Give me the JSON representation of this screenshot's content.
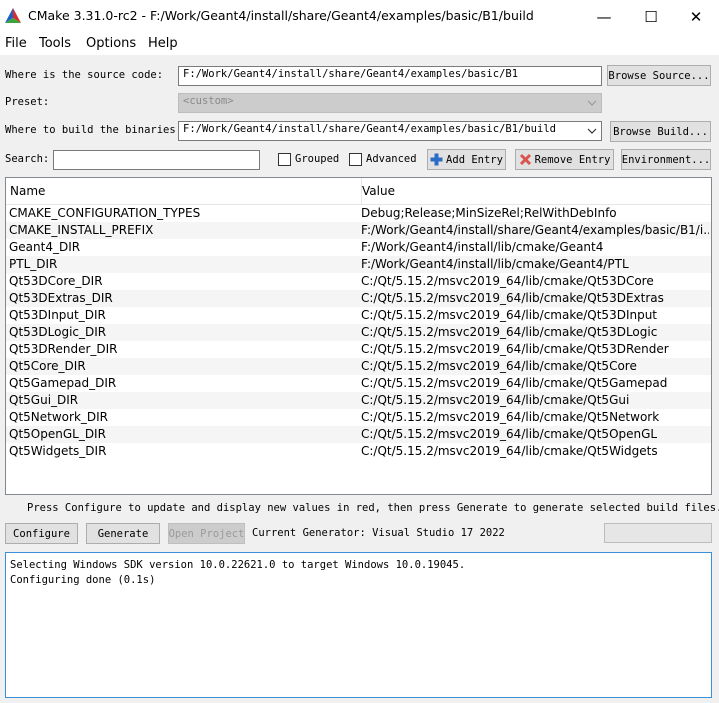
{
  "window": {
    "title": "CMake 3.31.0-rc2 - F:/Work/Geant4/install/share/Geant4/examples/basic/B1/build",
    "controls": {
      "minimize": "—",
      "maximize": "☐",
      "close": "✕"
    }
  },
  "menu": [
    "File",
    "Tools",
    "Options",
    "Help"
  ],
  "source": {
    "label": "Where is the source code:",
    "value": "F:/Work/Geant4/install/share/Geant4/examples/basic/B1",
    "button": "Browse Source..."
  },
  "preset": {
    "label": "Preset:",
    "value": "<custom>"
  },
  "build": {
    "label": "Where to build the binaries:",
    "value": "F:/Work/Geant4/install/share/Geant4/examples/basic/B1/build",
    "button": "Browse Build..."
  },
  "search": {
    "label": "Search:",
    "value": ""
  },
  "options": {
    "grouped": "Grouped",
    "advanced": "Advanced"
  },
  "toolbar": {
    "add_entry": "Add Entry",
    "remove_entry": "Remove Entry",
    "environment": "Environment..."
  },
  "table": {
    "headers": {
      "name": "Name",
      "value": "Value"
    },
    "rows": [
      {
        "name": "CMAKE_CONFIGURATION_TYPES",
        "value": "Debug;Release;MinSizeRel;RelWithDebInfo"
      },
      {
        "name": "CMAKE_INSTALL_PREFIX",
        "value": "F:/Work/Geant4/install/share/Geant4/examples/basic/B1/i..."
      },
      {
        "name": "Geant4_DIR",
        "value": "F:/Work/Geant4/install/lib/cmake/Geant4"
      },
      {
        "name": "PTL_DIR",
        "value": "F:/Work/Geant4/install/lib/cmake/Geant4/PTL"
      },
      {
        "name": "Qt53DCore_DIR",
        "value": "C:/Qt/5.15.2/msvc2019_64/lib/cmake/Qt53DCore"
      },
      {
        "name": "Qt53DExtras_DIR",
        "value": "C:/Qt/5.15.2/msvc2019_64/lib/cmake/Qt53DExtras"
      },
      {
        "name": "Qt53DInput_DIR",
        "value": "C:/Qt/5.15.2/msvc2019_64/lib/cmake/Qt53DInput"
      },
      {
        "name": "Qt53DLogic_DIR",
        "value": "C:/Qt/5.15.2/msvc2019_64/lib/cmake/Qt53DLogic"
      },
      {
        "name": "Qt53DRender_DIR",
        "value": "C:/Qt/5.15.2/msvc2019_64/lib/cmake/Qt53DRender"
      },
      {
        "name": "Qt5Core_DIR",
        "value": "C:/Qt/5.15.2/msvc2019_64/lib/cmake/Qt5Core"
      },
      {
        "name": "Qt5Gamepad_DIR",
        "value": "C:/Qt/5.15.2/msvc2019_64/lib/cmake/Qt5Gamepad"
      },
      {
        "name": "Qt5Gui_DIR",
        "value": "C:/Qt/5.15.2/msvc2019_64/lib/cmake/Qt5Gui"
      },
      {
        "name": "Qt5Network_DIR",
        "value": "C:/Qt/5.15.2/msvc2019_64/lib/cmake/Qt5Network"
      },
      {
        "name": "Qt5OpenGL_DIR",
        "value": "C:/Qt/5.15.2/msvc2019_64/lib/cmake/Qt5OpenGL"
      },
      {
        "name": "Qt5Widgets_DIR",
        "value": "C:/Qt/5.15.2/msvc2019_64/lib/cmake/Qt5Widgets"
      }
    ]
  },
  "hint": "Press Configure to update and display new values in red, then press Generate to generate selected build files.",
  "actions": {
    "configure": "Configure",
    "generate": "Generate",
    "open_project": "Open Project",
    "generator": "Current Generator: Visual Studio 17 2022"
  },
  "output": {
    "lines": [
      "Selecting Windows SDK version 10.0.22621.0 to target Windows 10.0.19045.",
      "Configuring done (0.1s)"
    ]
  },
  "colors": {
    "accent": "#0078d7",
    "remove_icon": "#d9534f",
    "add_icon": "#2b6cc4"
  }
}
